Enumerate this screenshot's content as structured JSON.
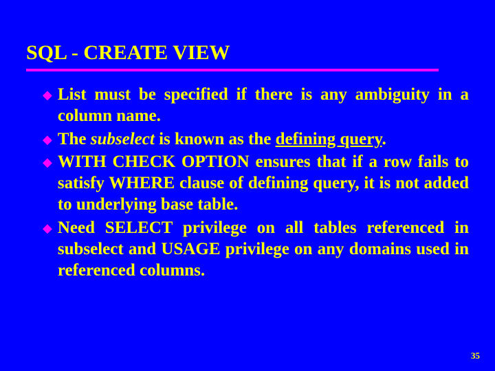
{
  "title": "SQL - CREATE VIEW",
  "bullets": [
    {
      "pre": "List must be specified if there is any ambiguity in a column name."
    },
    {
      "pre": "The ",
      "italic": "subselect",
      "mid": " is known as the ",
      "underline": "defining query",
      "post": "."
    },
    {
      "pre": "WITH CHECK OPTION ensures that if a row fails to satisfy WHERE clause of defining query, it is not added to underlying base table."
    },
    {
      "pre": "Need SELECT privilege on all tables referenced in subselect and USAGE privilege on any domains used in referenced columns."
    }
  ],
  "page_number": "35"
}
